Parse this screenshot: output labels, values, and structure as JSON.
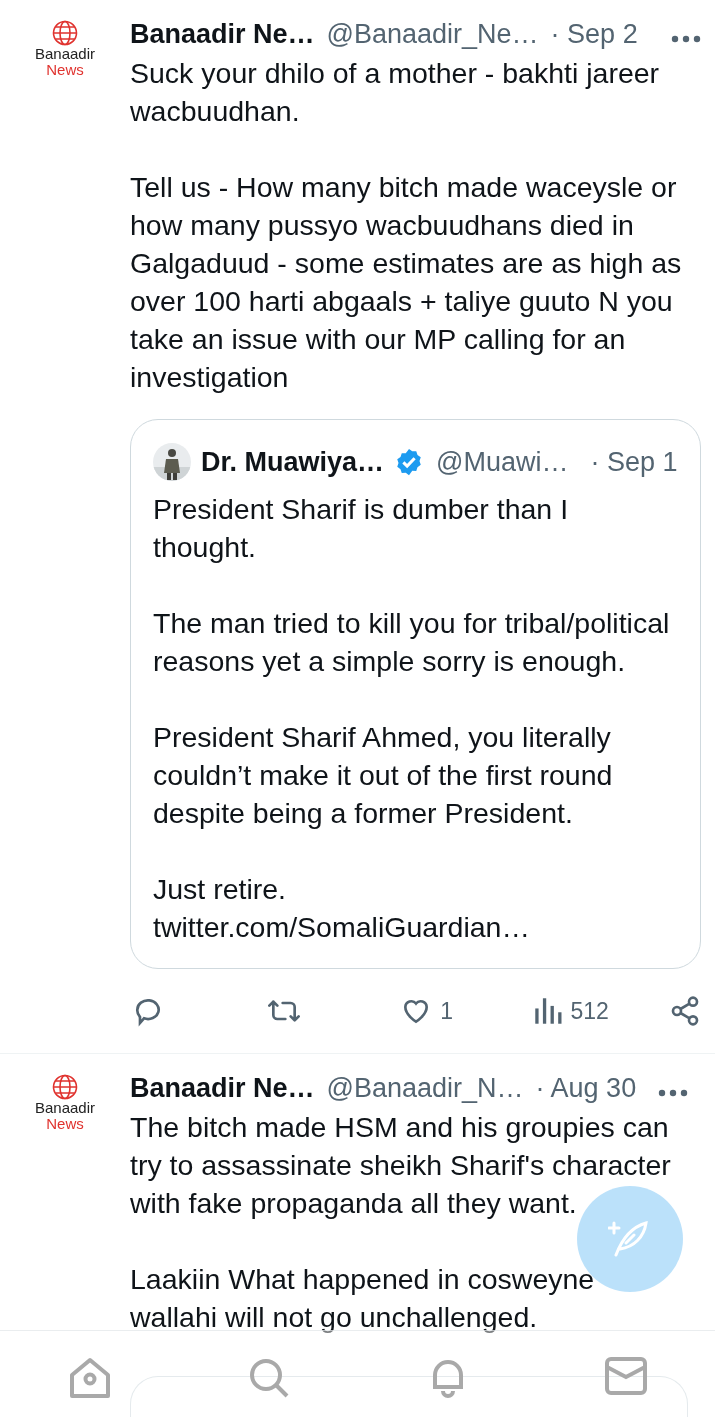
{
  "tweets": [
    {
      "author": {
        "name": "Banaadir Ne…",
        "handle": "@Banaadir_Ne…",
        "time": "· Sep 2",
        "logo_lines": [
          "Banaadir",
          "News"
        ]
      },
      "paragraphs": [
        "Suck your dhilo of a mother - bakhti jareer wacbuudhan.",
        "Tell us - How many bitch made waceysle or how many pussyo wacbuudhans died in Galgaduud - some estimates are as high as over 100 harti abgaals + taliye guuto N you take an issue with our MP calling for an investigation"
      ],
      "quote": {
        "author": {
          "name": "Dr. Muawiya…",
          "verified": true,
          "handle": "@Muawi…",
          "time": "· Sep 1"
        },
        "paragraphs": [
          "President Sharif is dumber than I thought.",
          "The man tried to kill you for tribal/political reasons yet a simple sorry is enough.",
          "President Sharif Ahmed, you literally couldn’t make it out of the first round despite being a former President.",
          "Just retire.\ntwitter.com/SomaliGuardian…"
        ]
      },
      "actions": [
        {
          "kind": "reply"
        },
        {
          "kind": "retweet"
        },
        {
          "kind": "like",
          "count": "1"
        },
        {
          "kind": "views",
          "count": "512"
        },
        {
          "kind": "share"
        }
      ]
    },
    {
      "author": {
        "name": "Banaadir Ne…",
        "handle": "@Banaadir_N…",
        "time": "· Aug 30",
        "logo_lines": [
          "Banaadir",
          "News"
        ]
      },
      "paragraphs": [
        "The bitch made HSM and his groupies can try to assassinate sheikh Sharif's character with fake propaganda all they want.",
        "Laakiin What happened in cosweyne wallahi will not go unchallenged."
      ],
      "has_quote": true
    }
  ]
}
